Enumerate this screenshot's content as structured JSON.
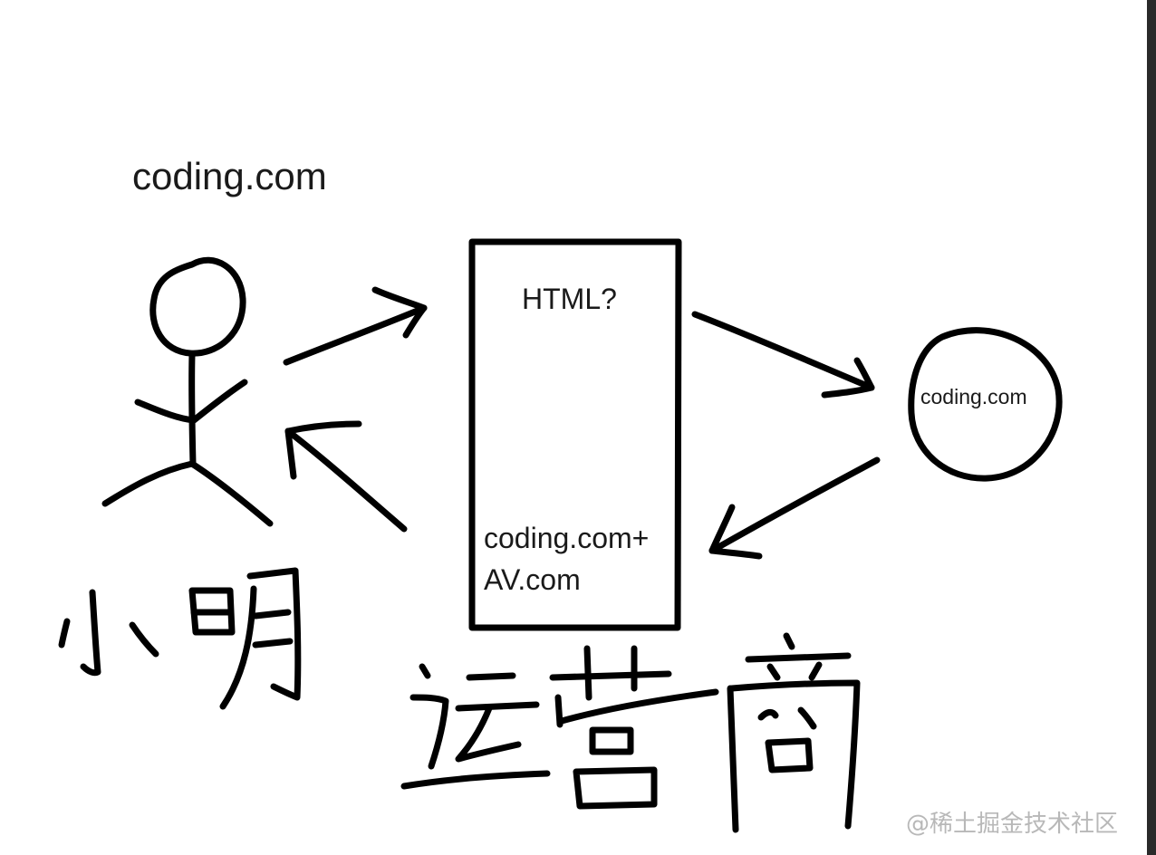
{
  "labels": {
    "site": "coding.com",
    "box_question": "HTML?",
    "box_result_line1": "coding.com+",
    "box_result_line2": "AV.com",
    "server": "coding.com",
    "person_name": "小明",
    "operator": "运营商"
  },
  "watermark": "@稀土掘金技术社区",
  "icons": {
    "person": "stick-figure-icon",
    "server": "circle-icon",
    "box": "rectangle-icon"
  },
  "colors": {
    "ink": "#000000",
    "watermark": "#b8b8b8",
    "background": "#ffffff"
  }
}
